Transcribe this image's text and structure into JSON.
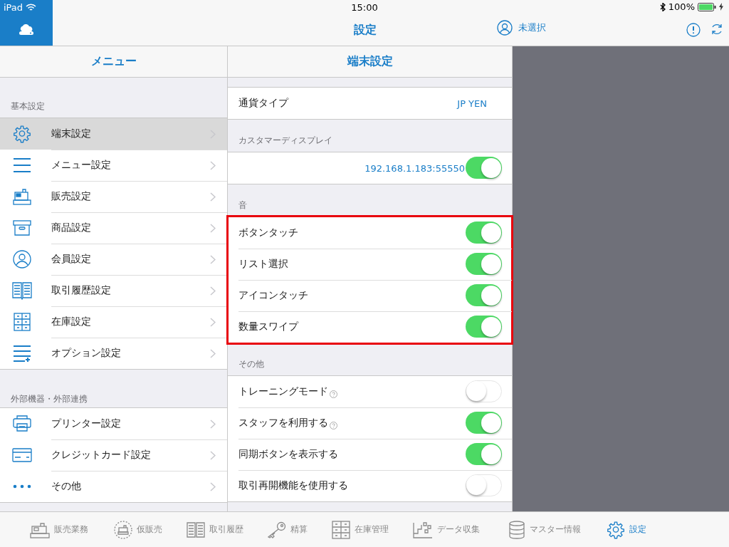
{
  "status_bar": {
    "device": "iPad",
    "time": "15:00",
    "battery": "100%"
  },
  "nav_bar": {
    "title": "設定",
    "user": "未選択"
  },
  "menu": {
    "title": "メニュー",
    "groups": [
      {
        "header": "基本設定",
        "items": [
          {
            "label": "端末設定",
            "selected": true
          },
          {
            "label": "メニュー設定",
            "selected": false
          },
          {
            "label": "販売設定",
            "selected": false
          },
          {
            "label": "商品設定",
            "selected": false
          },
          {
            "label": "会員設定",
            "selected": false
          },
          {
            "label": "取引履歴設定",
            "selected": false
          },
          {
            "label": "在庫設定",
            "selected": false
          },
          {
            "label": "オプション設定",
            "selected": false
          }
        ]
      },
      {
        "header": "外部機器・外部連携",
        "items": [
          {
            "label": "プリンター設定",
            "selected": false
          },
          {
            "label": "クレジットカード設定",
            "selected": false
          },
          {
            "label": "その他",
            "selected": false
          }
        ]
      }
    ]
  },
  "detail": {
    "title": "端末設定",
    "sections": [
      {
        "highlighted": false,
        "rows": [
          {
            "kind": "value",
            "label": "通貨タイプ",
            "value": "JP YEN"
          }
        ]
      },
      {
        "header": "カスタマーディスプレイ",
        "highlighted": false,
        "rows": [
          {
            "kind": "toggle",
            "value": "192.168.1.183:55550",
            "on": true
          }
        ]
      },
      {
        "header": "音",
        "highlighted": true,
        "rows": [
          {
            "kind": "toggle",
            "label": "ボタンタッチ",
            "on": true
          },
          {
            "kind": "toggle",
            "label": "リスト選択",
            "on": true
          },
          {
            "kind": "toggle",
            "label": "アイコンタッチ",
            "on": true
          },
          {
            "kind": "toggle",
            "label": "数量スワイプ",
            "on": true
          }
        ]
      },
      {
        "header": "その他",
        "highlighted": false,
        "rows": [
          {
            "kind": "toggle",
            "label": "トレーニングモード",
            "help": true,
            "on": false
          },
          {
            "kind": "toggle",
            "label": "スタッフを利用する",
            "help": true,
            "on": true
          },
          {
            "kind": "toggle",
            "label": "同期ボタンを表示する",
            "on": true
          },
          {
            "kind": "toggle",
            "label": "取引再開機能を使用する",
            "on": false
          }
        ]
      }
    ]
  },
  "tab_bar": [
    {
      "label": "販売業務",
      "selected": false
    },
    {
      "label": "仮販売",
      "selected": false
    },
    {
      "label": "取引履歴",
      "selected": false
    },
    {
      "label": "精算",
      "selected": false
    },
    {
      "label": "在庫管理",
      "selected": false
    },
    {
      "label": "データ収集",
      "selected": false
    },
    {
      "label": "マスター情報",
      "selected": false
    },
    {
      "label": "設定",
      "selected": true
    }
  ]
}
